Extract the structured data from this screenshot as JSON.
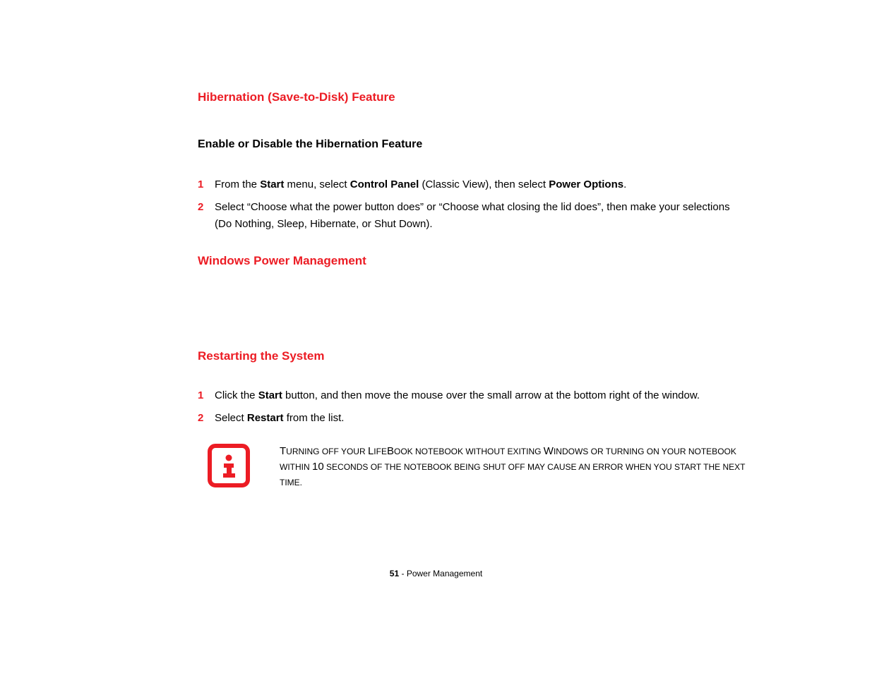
{
  "headings": {
    "h1": "Hibernation (Save-to-Disk) Feature",
    "h2": "Enable or Disable the Hibernation Feature",
    "h3": "Windows Power Management",
    "h4": "Restarting the System"
  },
  "list1": {
    "item1_num": "1",
    "item1_a": "From the ",
    "item1_b": "Start",
    "item1_c": " menu, select ",
    "item1_d": "Control Panel",
    "item1_e": " (Classic View), then select ",
    "item1_f": "Power Options",
    "item1_g": ".",
    "item2_num": "2",
    "item2_text": "Select “Choose what the power button does” or “Choose what closing the lid does”, then make your selections (Do Nothing, Sleep, Hibernate, or Shut Down)."
  },
  "list2": {
    "item1_num": "1",
    "item1_a": "Click the ",
    "item1_b": "Start",
    "item1_c": " button, and then move the mouse over the small arrow at the bottom right of the window.",
    "item2_num": "2",
    "item2_a": "Select ",
    "item2_b": "Restart",
    "item2_c": " from the list."
  },
  "info": {
    "seg1a": "T",
    "seg1b": "urning off your ",
    "seg2a": "L",
    "seg2b": "ife",
    "seg3a": "B",
    "seg3b": "ook notebook without exiting ",
    "seg4a": "W",
    "seg4b": "indows or turning on your notebook within ",
    "seg5": "10",
    "seg6": " seconds of the notebook being shut off may cause an error when you start the next time."
  },
  "footer": {
    "page_number": "51",
    "separator": " - ",
    "section": "Power Management"
  }
}
